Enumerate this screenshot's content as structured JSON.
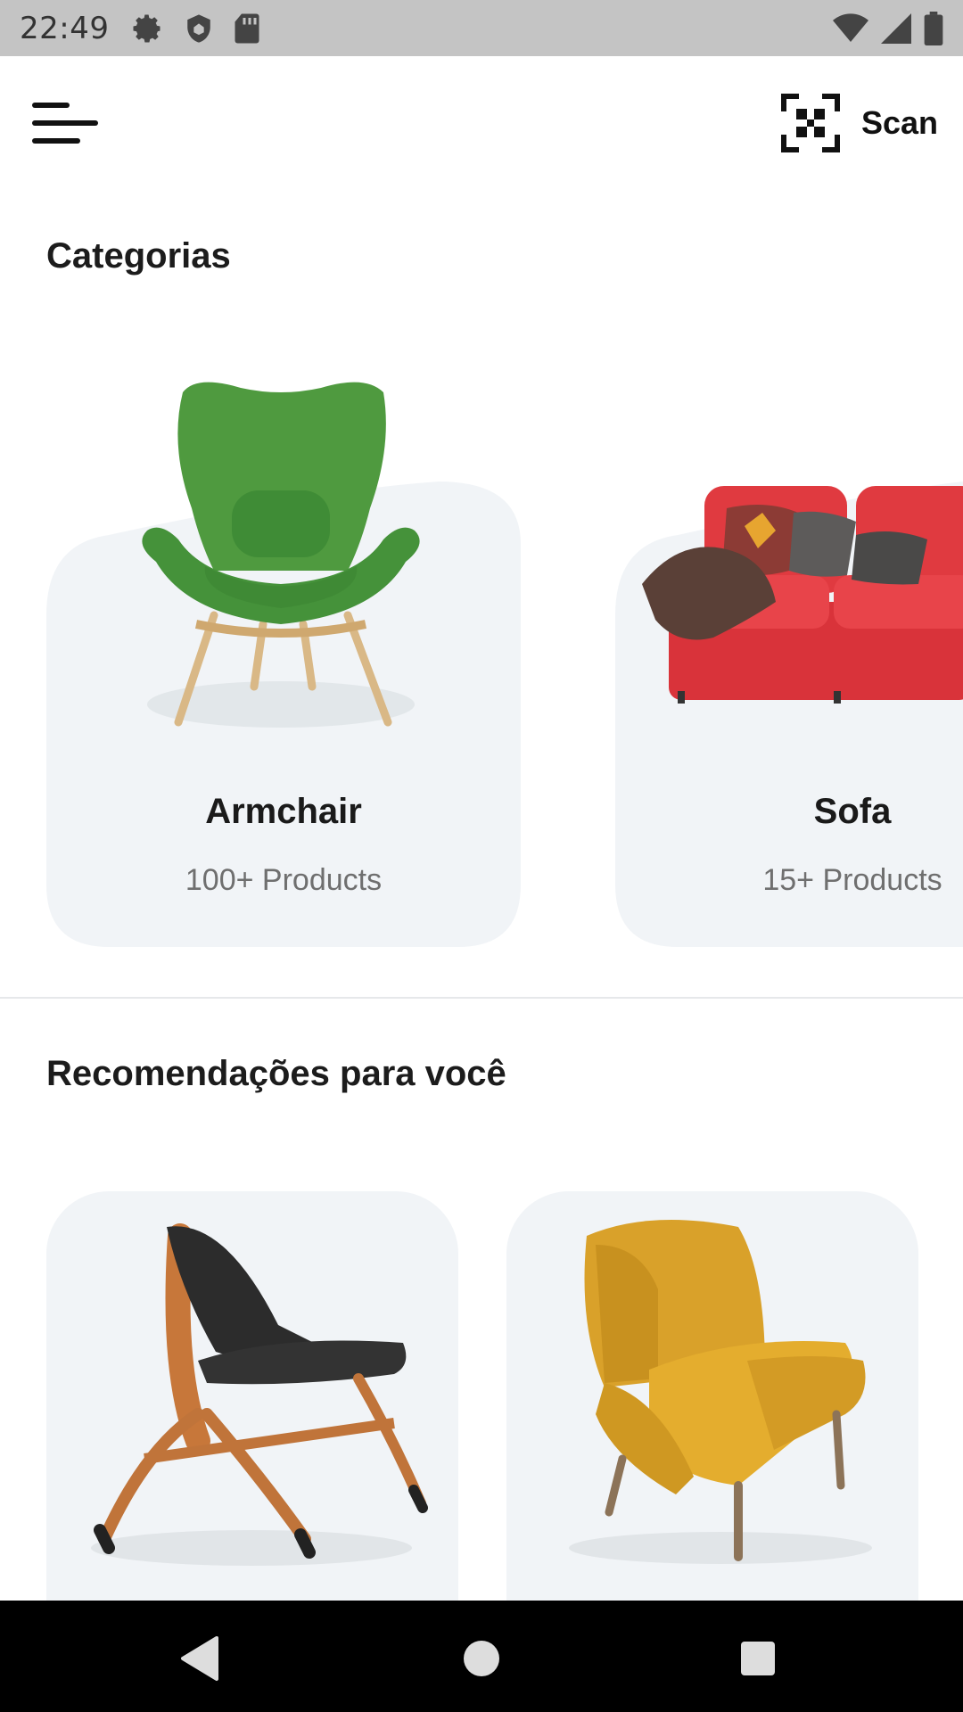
{
  "status_bar": {
    "time": "22:49",
    "left_icons": [
      "settings-icon",
      "shield-icon",
      "sd-card-icon"
    ],
    "right_icons": [
      "wifi-icon",
      "signal-icon",
      "battery-icon"
    ]
  },
  "app_bar": {
    "menu_icon": "menu-icon",
    "scan_icon": "qr-scan-icon",
    "scan_label": "Scan"
  },
  "categories": {
    "title": "Categorias",
    "items": [
      {
        "name": "Armchair",
        "count": "100+ Products",
        "image": "green-armchair"
      },
      {
        "name": "Sofa",
        "count": "15+ Products",
        "image": "red-sofa"
      }
    ]
  },
  "recommendations": {
    "title": "Recomendações para você",
    "items": [
      {
        "image": "black-wooden-chair"
      },
      {
        "image": "yellow-armchair"
      }
    ]
  },
  "nav_bar": {
    "back_icon": "back-icon",
    "home_icon": "home-icon",
    "recents_icon": "recents-icon"
  },
  "colors": {
    "status_bar": "#c4c4c4",
    "card_bg": "#f1f4f7",
    "nav_bar": "#000000",
    "text_primary": "#1a1a1a",
    "text_secondary": "#6f6f6f"
  }
}
